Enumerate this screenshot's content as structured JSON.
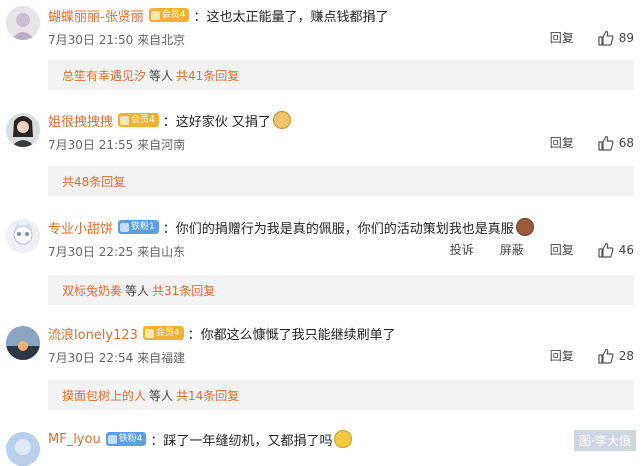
{
  "comments": [
    {
      "username": "蝴蝶丽丽-张贤丽",
      "badge": "会员4",
      "badge_color": "#f2b230",
      "text": "：这也太正能量了，赚点钱都捐了",
      "time_place": "7月30日 21:50 来自北京",
      "reply_label": "回复",
      "likes": "89",
      "replies_preview": {
        "name": "总笙有幸遇见汐",
        "mid": "等人",
        "count": "共41条回复"
      }
    },
    {
      "username": "姐很拽拽拽",
      "badge": "会员4",
      "badge_color": "#f2b230",
      "text": "：这好家伙 又捐了",
      "time_place": "7月30日 21:55 来自河南",
      "reply_label": "回复",
      "likes": "68",
      "replies_preview": {
        "name": "",
        "mid": "",
        "count": "共48条回复"
      }
    },
    {
      "username": "专业小甜饼",
      "badge": "铁粉1",
      "badge_color": "#5a9ee8",
      "text": "：你们的捐赠行为我是真的佩服，你们的活动策划我也是真服",
      "time_place": "7月30日 22:25 来自山东",
      "report_label": "投诉",
      "block_label": "屏蔽",
      "reply_label": "回复",
      "likes": "46",
      "replies_preview": {
        "name": "双标兔奶奏",
        "mid": "等人",
        "count": "共31条回复"
      }
    },
    {
      "username": "流浪lonely123",
      "badge": "会员4",
      "badge_color": "#f2b230",
      "text": "：你都这么慷慨了我只能继续刷单了",
      "time_place": "7月30日 22:54 来自福建",
      "reply_label": "回复",
      "likes": "28",
      "replies_preview": {
        "name": "摸面包树上的人",
        "mid": "等人",
        "count": "共14条回复"
      }
    },
    {
      "username": "MF_lyou",
      "badge": "铁粉4",
      "badge_color": "#5a9ee8",
      "text": "：踩了一年缝纫机，又都捐了吗"
    }
  ],
  "watermark": "图·李大恒",
  "colors": {
    "username": "#e06d2f",
    "reply_bg": "#f3f3f3",
    "text": "#222222",
    "meta": "#666666"
  },
  "icons": {
    "like": "thumbs-up-icon"
  }
}
